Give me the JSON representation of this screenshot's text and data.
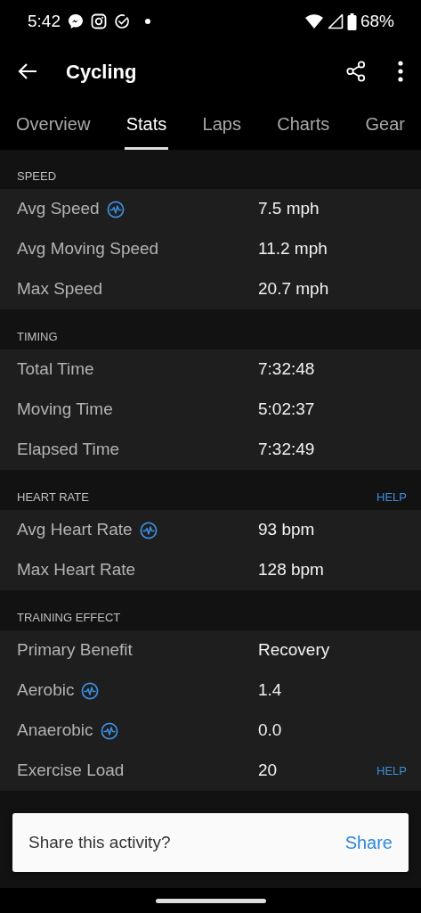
{
  "status_bar": {
    "time": "5:42",
    "battery": "68%"
  },
  "app_bar": {
    "title": "Cycling"
  },
  "tabs": [
    {
      "label": "Overview",
      "selected": false
    },
    {
      "label": "Stats",
      "selected": true
    },
    {
      "label": "Laps",
      "selected": false
    },
    {
      "label": "Charts",
      "selected": false
    },
    {
      "label": "Gear",
      "selected": false
    }
  ],
  "sections": [
    {
      "title": "SPEED",
      "rows": [
        {
          "label": "Avg Speed",
          "value": "7.5 mph",
          "trend_icon": true
        },
        {
          "label": "Avg Moving Speed",
          "value": "11.2 mph"
        },
        {
          "label": "Max Speed",
          "value": "20.7 mph"
        }
      ]
    },
    {
      "title": "TIMING",
      "rows": [
        {
          "label": "Total Time",
          "value": "7:32:48"
        },
        {
          "label": "Moving Time",
          "value": "5:02:37"
        },
        {
          "label": "Elapsed Time",
          "value": "7:32:49"
        }
      ]
    },
    {
      "title": "HEART RATE",
      "help": "HELP",
      "rows": [
        {
          "label": "Avg Heart Rate",
          "value": "93 bpm",
          "trend_icon": true
        },
        {
          "label": "Max Heart Rate",
          "value": "128 bpm"
        }
      ]
    },
    {
      "title": "TRAINING EFFECT",
      "rows": [
        {
          "label": "Primary Benefit",
          "value": "Recovery"
        },
        {
          "label": "Aerobic",
          "value": "1.4",
          "trend_icon": true
        },
        {
          "label": "Anaerobic",
          "value": "0.0",
          "trend_icon": true
        },
        {
          "label": "Exercise Load",
          "value": "20",
          "help": "HELP"
        }
      ]
    }
  ],
  "snackbar": {
    "message": "Share this activity?",
    "action": "Share"
  }
}
